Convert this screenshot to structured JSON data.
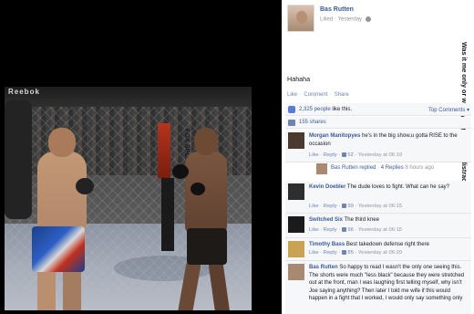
{
  "photo": {
    "arena_banner": "Reebok",
    "post_sign": "FOX SPORTS"
  },
  "post": {
    "author": "Bas Rutten",
    "meta_liked": "Liked",
    "meta_time": "Yesterday",
    "text": "Was it me only or were you guys also distracted by something in this fight?",
    "haha": "Hahaha",
    "actions": {
      "like": "Like",
      "comment": "Comment",
      "share": "Share",
      "sep": "·"
    },
    "likes": {
      "count_link": "2,325 people",
      "suffix": "like this.",
      "top_comments": "Top Comments ▾"
    },
    "shares": "155 shares"
  },
  "comments": [
    {
      "name": "Morgan Manitopyes",
      "text": "he's in the big show,u gotta RISE to the occasion",
      "like": "Like",
      "reply": "Reply",
      "count": "52",
      "time": "Yesterday at 06:19",
      "avatar_color": "#4a3a30"
    },
    {
      "name": "Kevin Doebler",
      "text": "The dude loves to fight. What can he say?",
      "like": "Like",
      "reply": "Reply",
      "count": "99",
      "time": "Yesterday at 06:15",
      "avatar_color": "#2e2e2e"
    },
    {
      "name": "Switched Six",
      "text": "The third knee",
      "like": "Like",
      "reply": "Reply",
      "count": "96",
      "time": "Yesterday at 06:15",
      "avatar_color": "#1b1b1b"
    },
    {
      "name": "Timothy Bass",
      "text": "Best takedown defense right there",
      "like": "Like",
      "reply": "Reply",
      "count": "85",
      "time": "Yesterday at 06:20",
      "avatar_color": "#c9a253"
    },
    {
      "name": "Bas Rutten",
      "text": "So happy to read I wasn't the only one seeing this. The shorts were much \"less black\" because they were stretched out at the front, man I was laughing first telling myself, why isn't Joe saying anything? Then later I told me wife if this would happen in a fight that I worked, I would only say something only",
      "avatar_color": "#a88a73"
    }
  ],
  "reply_summary": {
    "author": "Bas Rutten",
    "replied": "replied",
    "sep": "·",
    "count": "4 Replies",
    "time": "8 hours ago"
  }
}
